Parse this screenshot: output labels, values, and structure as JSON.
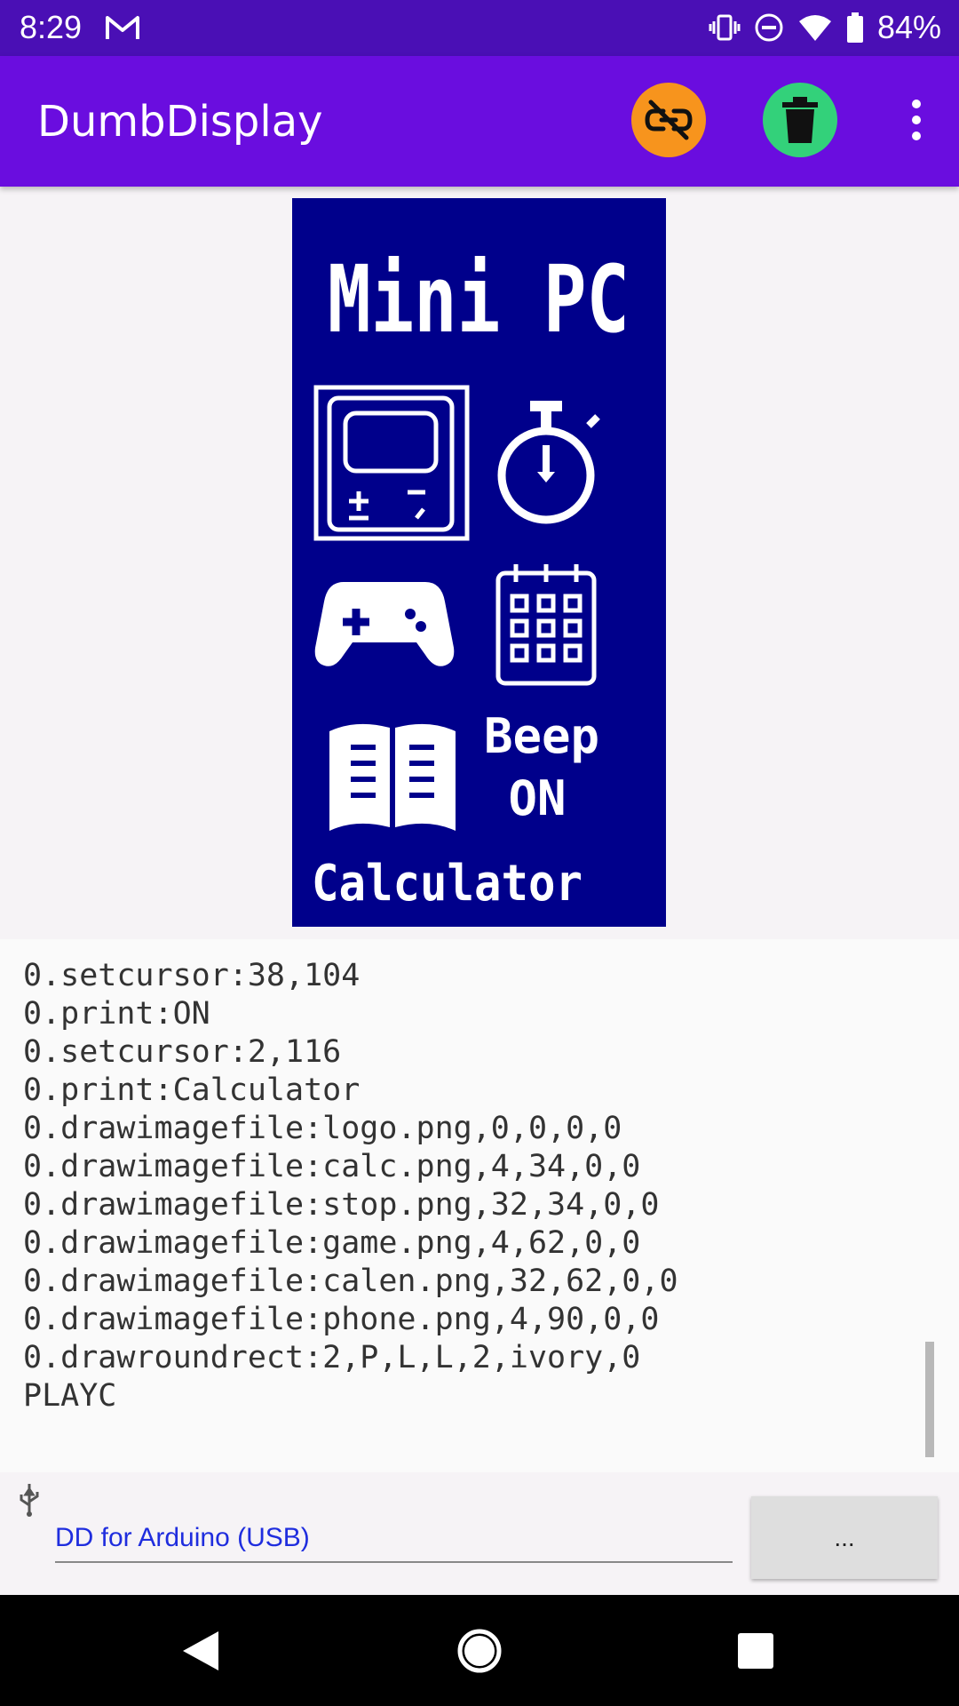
{
  "status": {
    "time": "8:29",
    "battery": "84%"
  },
  "appbar": {
    "title": "DumbDisplay",
    "icons": [
      "link-off-icon",
      "trash-icon",
      "more-vert-icon"
    ],
    "colors": {
      "bar": "#6a0ddf",
      "link_button": "#f7941d",
      "trash_button": "#33d17a"
    }
  },
  "display": {
    "title": "Mini PC",
    "beep_label": "Beep",
    "beep_state": "ON",
    "selected_label": "Calculator",
    "icons": [
      "calculator-icon",
      "stopwatch-icon",
      "gamepad-icon",
      "calendar-icon",
      "phonebook-icon"
    ],
    "background": "#00008b"
  },
  "log": {
    "lines": [
      "0.setcursor:38,104",
      "0.print:ON",
      "0.setcursor:2,116",
      "0.print:Calculator",
      "0.drawimagefile:logo.png,0,0,0,0",
      "0.drawimagefile:calc.png,4,34,0,0",
      "0.drawimagefile:stop.png,32,34,0,0",
      "0.drawimagefile:game.png,4,62,0,0",
      "0.drawimagefile:calen.png,32,62,0,0",
      "0.drawimagefile:phone.png,4,90,0,0",
      "0.drawroundrect:2,P,L,L,2,ivory,0",
      "PLAYC"
    ]
  },
  "connection": {
    "name": "DD for Arduino (USB)",
    "button_label": "..."
  }
}
